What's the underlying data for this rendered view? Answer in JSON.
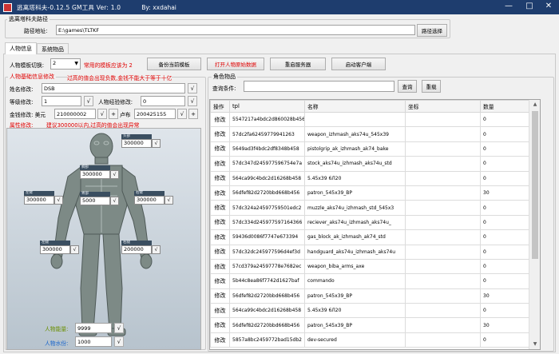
{
  "window": {
    "title": "逃离塔科夫-0.12.5 GM工具 Ver: 1.0",
    "author": "By: xxdahai",
    "minimize": "—",
    "maximize": "□",
    "close": "✕"
  },
  "path_group": {
    "title": "逃离塔科夫路径",
    "label": "路径地址:",
    "value": "E:\\games\\TLTKF",
    "button": "路径选择"
  },
  "tabs": [
    "人物信息",
    "系统物品"
  ],
  "toolbar": {
    "template_label": "人物模板切换:",
    "template_value": "2",
    "hint": "常用的模板应该为 2",
    "backup_button": "备份当前模板",
    "open_data_button": "打开人物原始数据",
    "restart_button": "重启服务器",
    "start_client_button": "启动客户端"
  },
  "basic": {
    "title": "人物基础信息修改",
    "warning": "过高的值会出现负数,金钱不能大于等于十亿",
    "name_label": "姓名修改:",
    "name_value": "DSB",
    "level_label": "等级修改:",
    "level_value": "1",
    "exp_label": "人物经验修改:",
    "exp_value": "0",
    "money_label": "金钱修改: 美元",
    "usd_value": "210000002",
    "rub_label": "卢布",
    "rub_value": "200425155",
    "hp_label": "属性修改:",
    "hp_hint": "建议300000以内,过高的值会出现异常",
    "ok": "√",
    "plus": "+"
  },
  "body_parts": [
    {
      "name": "head",
      "head": "头部",
      "value": "300000"
    },
    {
      "name": "chest",
      "head": "胸部",
      "value": "300000"
    },
    {
      "name": "stomach",
      "head": "胃部",
      "value": "5000"
    },
    {
      "name": "left-arm",
      "head": "左臂",
      "value": "300000"
    },
    {
      "name": "right-arm",
      "head": "右臂",
      "value": "300000"
    },
    {
      "name": "left-leg",
      "head": "左腿",
      "value": "300000"
    },
    {
      "name": "right-leg",
      "head": "右腿",
      "value": "200000"
    }
  ],
  "stats": {
    "energy_label": "人物能量:",
    "energy_value": "9999",
    "water_label": "人物水份:",
    "water_value": "1000"
  },
  "items": {
    "title": "角色物品",
    "query_label": "查询条件:",
    "query_value": "",
    "query_button": "查询",
    "refresh_button": "重载",
    "columns": [
      "操作",
      "tpl",
      "名称",
      "坐标",
      "数量"
    ],
    "op_label": "修改",
    "rows": [
      {
        "tpl": "5547217a4bdc2d860028b456",
        "name": "",
        "pos": "",
        "qty": "0"
      },
      {
        "tpl": "57dc2fa62459779941263",
        "name": "weapon_izhmash_aks74u_545x39",
        "pos": "",
        "qty": "0"
      },
      {
        "tpl": "5649ad3f4bdc2df8348b458",
        "name": "pistolgrip_ak_izhmash_ak74_bake",
        "pos": "",
        "qty": "0"
      },
      {
        "tpl": "57dc347d245977596754e7a",
        "name": "stock_aks74u_izhmash_aks74u_std",
        "pos": "",
        "qty": "0"
      },
      {
        "tpl": "564ca99c4bdc2d16268b458",
        "name": "5.45x39 6Л20",
        "pos": "",
        "qty": "0"
      },
      {
        "tpl": "56dfef82d2720bbd668b456",
        "name": "patron_545x39_BP",
        "pos": "",
        "qty": "30"
      },
      {
        "tpl": "57dc324a24597759501edc2",
        "name": "muzzle_aks74u_izhmash_std_545x3",
        "pos": "",
        "qty": "0"
      },
      {
        "tpl": "57dc334d245977597164366",
        "name": "reciever_aks74u_izhmash_aks74u_",
        "pos": "",
        "qty": "0"
      },
      {
        "tpl": "59436d0086f7747e673394",
        "name": "gas_block_ak_izhmash_ak74_std",
        "pos": "",
        "qty": "0"
      },
      {
        "tpl": "57dc32dc245977596d4ef3d",
        "name": "handguard_aks74u_izhmash_aks74u",
        "pos": "",
        "qty": "0"
      },
      {
        "tpl": "57cd379a24597778e7682ec",
        "name": "weapon_biba_arms_axe",
        "pos": "",
        "qty": "0"
      },
      {
        "tpl": "5b44c8ea86f7742d1627baf",
        "name": "commando",
        "pos": "",
        "qty": "0"
      },
      {
        "tpl": "56dfef82d2720bbd668b456",
        "name": "patron_545x39_BP",
        "pos": "",
        "qty": "30"
      },
      {
        "tpl": "564ca99c4bdc2d16268b458",
        "name": "5.45x39 6Л20",
        "pos": "",
        "qty": "0"
      },
      {
        "tpl": "56dfef82d2720bbd668b456",
        "name": "patron_545x39_BP",
        "pos": "",
        "qty": "30"
      },
      {
        "tpl": "5857a8bc2459772bad15db2",
        "name": "dev-secured",
        "pos": "",
        "qty": "0"
      }
    ]
  }
}
